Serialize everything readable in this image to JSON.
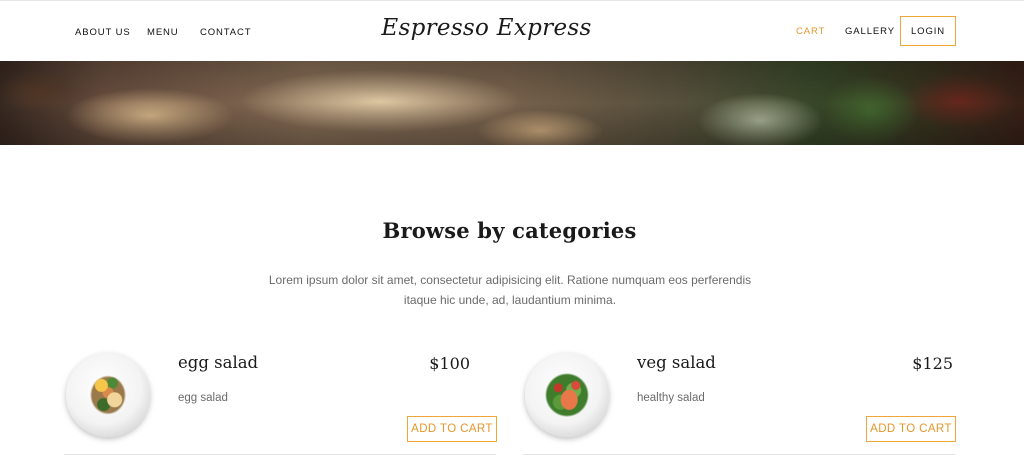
{
  "nav": {
    "left_links": [
      "ABOUT US",
      "MENU",
      "CONTACT"
    ],
    "brand": "Espresso Express",
    "cart": "CART",
    "gallery": "GALLERY",
    "login": "LOGIN",
    "accent_color": "#f0a73a"
  },
  "hero": {
    "image": "food-banner"
  },
  "section": {
    "title": "Browse by categories",
    "description": "Lorem ipsum dolor sit amet, consectetur adipisicing elit. Ratione numquam eos perferendis itaque hic unde, ad, laudantium minima."
  },
  "products": [
    {
      "name": "egg salad",
      "description": "egg salad",
      "price": "$100",
      "button": "ADD TO CART",
      "image": "egg-salad-plate"
    },
    {
      "name": "veg salad",
      "description": "healthy salad",
      "price": "$125",
      "button": "ADD TO CART",
      "image": "veg-salad-plate"
    }
  ]
}
